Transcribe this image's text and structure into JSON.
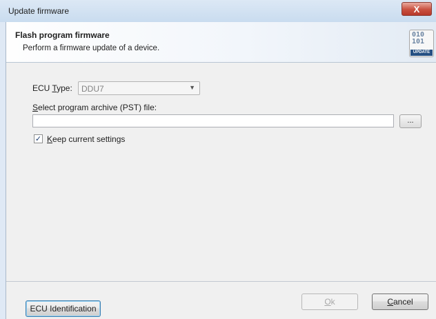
{
  "window": {
    "title": "Update firmware",
    "close_glyph": "X"
  },
  "header": {
    "title": "Flash program firmware",
    "subtitle": "Perform a firmware update of a device.",
    "icon": {
      "name": "update-icon",
      "bits_line1": "010",
      "bits_line2": "101",
      "label": "UPDATE"
    }
  },
  "form": {
    "ecu_type": {
      "label_pre": "ECU ",
      "label_accel": "T",
      "label_post": "ype:",
      "value": "DDU7"
    },
    "archive": {
      "label_accel": "S",
      "label_post": "elect program archive (PST) file:",
      "value": "",
      "browse_label": "..."
    },
    "keep_settings": {
      "checked": true,
      "check_glyph": "✓",
      "label_accel": "K",
      "label_post": "eep current settings"
    }
  },
  "footer": {
    "ecu_identification_label": "ECU Identification",
    "ok": {
      "accel": "O",
      "rest": "k",
      "enabled": false
    },
    "cancel": {
      "accel": "C",
      "rest": "ancel"
    }
  },
  "colors": {
    "titlebar": "#c9dcef",
    "close_button": "#c9513f",
    "client_bg": "#f0f0f0",
    "icon_label_bg": "#255083"
  }
}
